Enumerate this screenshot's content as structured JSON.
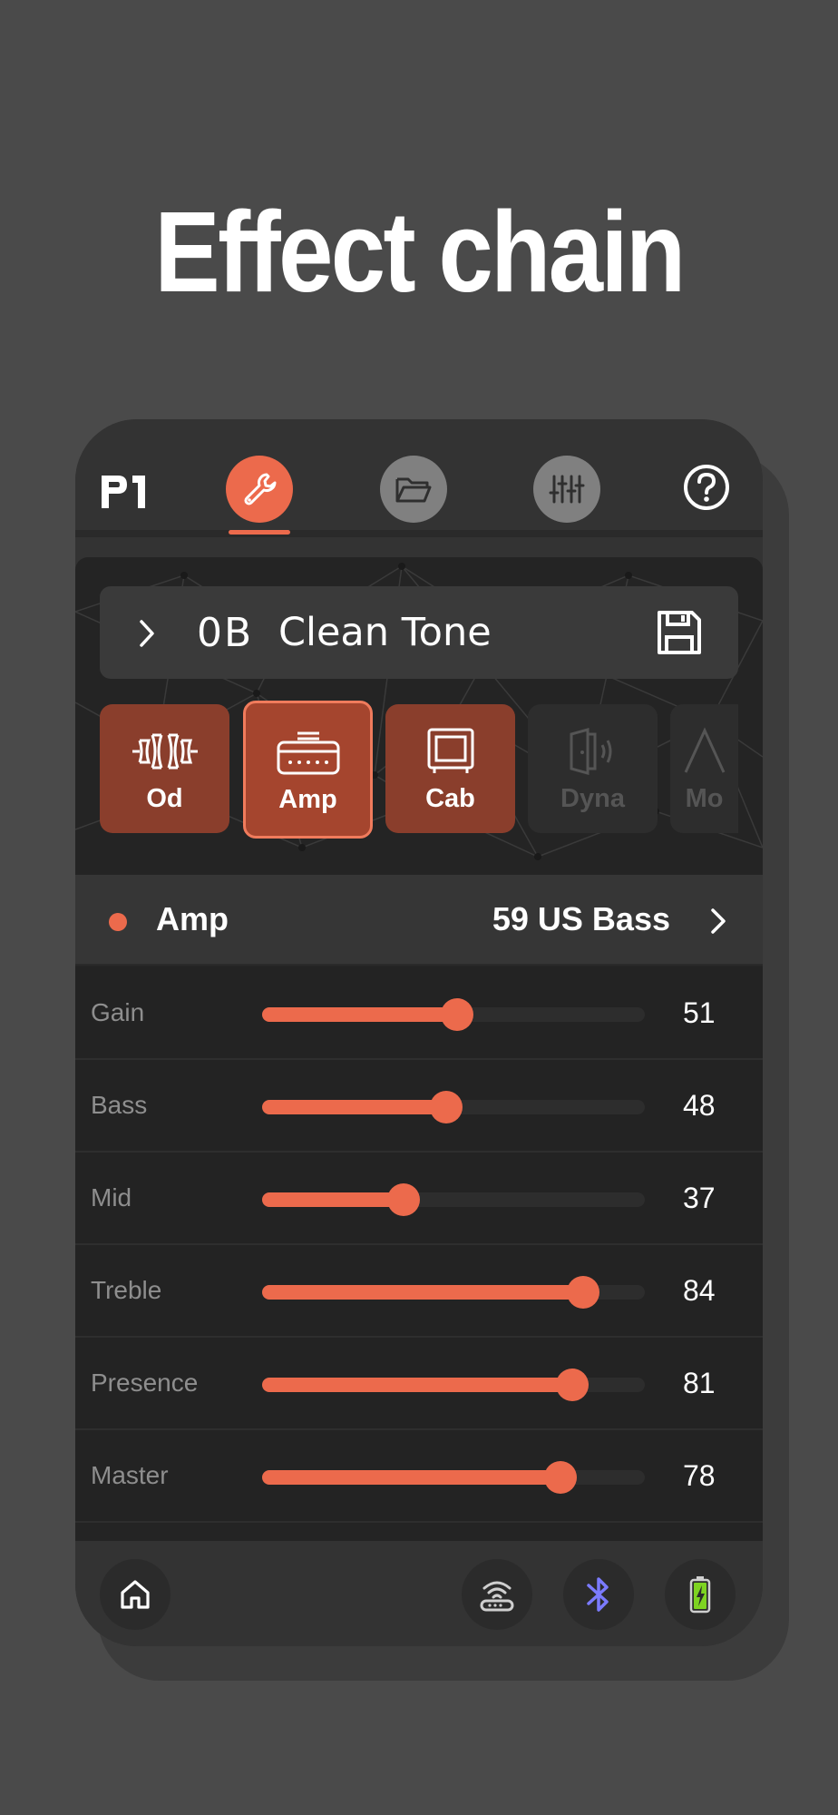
{
  "headline": "Effect chain",
  "app": {
    "logo_text": "P1",
    "nav": [
      {
        "name": "tools",
        "icon": "wrench-icon",
        "active": true
      },
      {
        "name": "presets",
        "icon": "folder-icon",
        "active": false
      },
      {
        "name": "mixer",
        "icon": "sliders-icon",
        "active": false
      },
      {
        "name": "help",
        "icon": "help-icon",
        "active": false
      }
    ],
    "accent_color": "#ec6a4c"
  },
  "preset": {
    "number": "0B",
    "name": "Clean Tone"
  },
  "blocks": [
    {
      "label": "Od",
      "icon": "overdrive-icon",
      "state": "on"
    },
    {
      "label": "Amp",
      "icon": "amp-icon",
      "state": "selected"
    },
    {
      "label": "Cab",
      "icon": "cabinet-icon",
      "state": "on"
    },
    {
      "label": "Dyna",
      "icon": "dynamics-icon",
      "state": "off"
    },
    {
      "label": "Mo",
      "icon": "modulation-icon",
      "state": "off"
    }
  ],
  "module": {
    "name": "Amp",
    "model": "59 US Bass"
  },
  "params": [
    {
      "label": "Gain",
      "value": "51",
      "level": 51
    },
    {
      "label": "Bass",
      "value": "48",
      "level": 48
    },
    {
      "label": "Mid",
      "value": "37",
      "level": 37
    },
    {
      "label": "Treble",
      "value": "84",
      "level": 84
    },
    {
      "label": "Presence",
      "value": "81",
      "level": 81
    },
    {
      "label": "Master",
      "value": "78",
      "level": 78
    }
  ],
  "status": {
    "icons": [
      "home-icon",
      "wireless-icon",
      "bluetooth-icon",
      "battery-icon"
    ],
    "bluetooth_color": "#7b7bff",
    "battery_color": "#7ed321"
  }
}
